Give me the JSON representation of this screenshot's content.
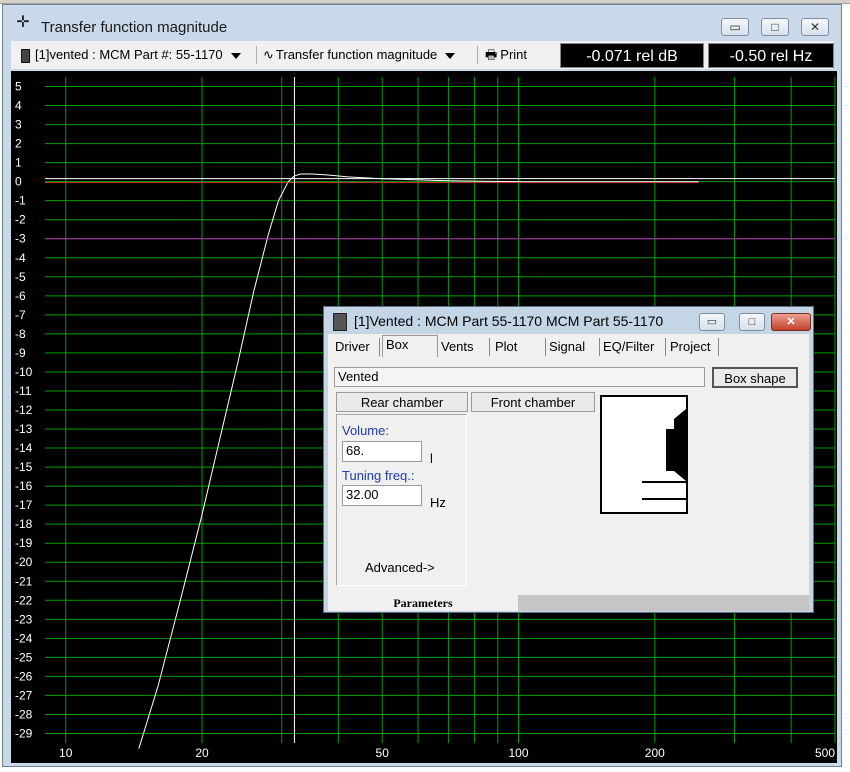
{
  "window": {
    "title": "Transfer function magnitude"
  },
  "toolbar": {
    "driver_select": "[1]vented : MCM Part #: 55-1170",
    "plot_select": "Transfer function magnitude",
    "print_label": "Print",
    "readout_db": "-0.071 rel dB",
    "readout_hz": "-0.50 rel Hz"
  },
  "chart_data": {
    "type": "line",
    "xscale": "log",
    "xlim": [
      9,
      500
    ],
    "ylim": [
      -29.5,
      5.5
    ],
    "x_tick_labels": [
      "10",
      "20",
      "50",
      "100",
      "200",
      "500"
    ],
    "x_tick_values": [
      10,
      20,
      50,
      100,
      200,
      500
    ],
    "y_tick_values": [
      5,
      4,
      3,
      2,
      1,
      0,
      -1,
      -2,
      -3,
      -4,
      -5,
      -6,
      -7,
      -8,
      -9,
      -10,
      -11,
      -12,
      -13,
      -14,
      -15,
      -16,
      -17,
      -18,
      -19,
      -20,
      -21,
      -22,
      -23,
      -24,
      -25,
      -26,
      -27,
      -28,
      -29
    ],
    "grid": true,
    "cursor": {
      "x": 32,
      "y": 0
    },
    "series": [
      {
        "color": "#ffffff",
        "points": [
          [
            14.5,
            -29.8
          ],
          [
            16,
            -26.5
          ],
          [
            18,
            -21.8
          ],
          [
            20,
            -17.5
          ],
          [
            22,
            -13.3
          ],
          [
            24,
            -9.5
          ],
          [
            26,
            -5.8
          ],
          [
            28,
            -2.8
          ],
          [
            29.5,
            -1.0
          ],
          [
            31,
            0.0
          ],
          [
            32,
            0.3
          ],
          [
            33,
            0.4
          ],
          [
            35,
            0.4
          ],
          [
            38,
            0.35
          ],
          [
            42,
            0.25
          ],
          [
            50,
            0.15
          ],
          [
            70,
            0.05
          ],
          [
            100,
            0.0
          ],
          [
            150,
            0.0
          ],
          [
            250,
            0.0
          ]
        ]
      },
      {
        "color": "#d03030",
        "points": [
          [
            9,
            -0.05
          ],
          [
            100,
            -0.05
          ],
          [
            250,
            -0.05
          ]
        ]
      },
      {
        "color": "#c020c0",
        "points": [
          [
            9,
            -3.0
          ],
          [
            500,
            -3.0
          ]
        ]
      }
    ]
  },
  "dialog": {
    "title": "[1]Vented : MCM Part 55-1170 MCM Part 55-1170",
    "tabs": [
      "Driver",
      "Box",
      "Vents",
      "Plot",
      "Signal",
      "EQ/Filter",
      "Project"
    ],
    "active_tab": "Box",
    "box_type": "Vented",
    "box_shape_button": "Box shape",
    "rear_chamber_button": "Rear chamber",
    "front_chamber_button": "Front chamber",
    "volume_label": "Volume:",
    "volume_value": "68.",
    "volume_unit": "l",
    "tuning_label": "Tuning freq.:",
    "tuning_value": "32.00",
    "tuning_unit": "Hz",
    "advanced_button": "Advanced->",
    "status_text": "Parameters"
  }
}
